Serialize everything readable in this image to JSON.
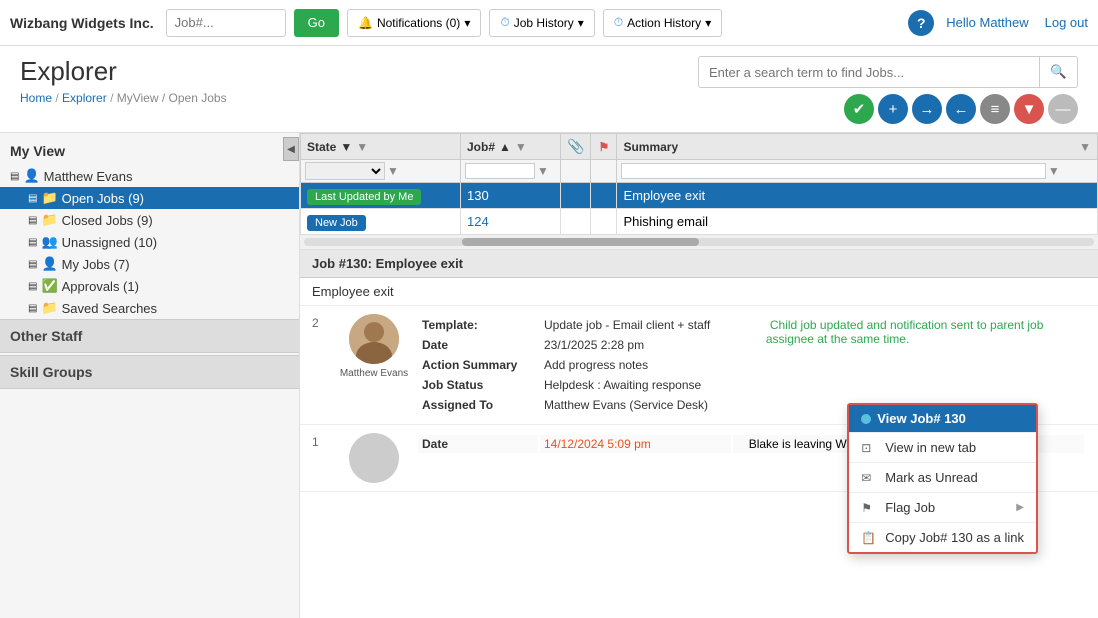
{
  "brand": "Wizbang Widgets Inc.",
  "nav": {
    "job_placeholder": "Job#...",
    "go_label": "Go",
    "notifications_label": "Notifications (0)",
    "job_history_label": "Job History",
    "action_history_label": "Action History",
    "hello_label": "Hello Matthew",
    "logout_label": "Log out"
  },
  "page": {
    "title": "Explorer",
    "breadcrumb_home": "Home",
    "breadcrumb_explorer": "Explorer",
    "breadcrumb_current": "MyView / Open Jobs",
    "search_placeholder": "Enter a search term to find Jobs..."
  },
  "toolbar": {
    "icons": [
      "✔",
      "+",
      "→",
      "←",
      "≡",
      "▼",
      "—"
    ]
  },
  "sidebar": {
    "title": "My View",
    "user": "Matthew Evans",
    "items": [
      {
        "label": "Open Jobs (9)",
        "active": true,
        "icon": "📁",
        "count": "9"
      },
      {
        "label": "Closed Jobs (9)",
        "active": false,
        "icon": "📁",
        "count": "9"
      },
      {
        "label": "Unassigned (10)",
        "active": false,
        "icon": "👥",
        "count": "10"
      },
      {
        "label": "My Jobs (7)",
        "active": false,
        "icon": "👤",
        "count": "7"
      },
      {
        "label": "Approvals (1)",
        "active": false,
        "icon": "✅",
        "count": "1"
      },
      {
        "label": "Saved Searches",
        "active": false,
        "icon": "📁"
      }
    ],
    "other_staff_label": "Other Staff",
    "skill_groups_label": "Skill Groups"
  },
  "table": {
    "columns": [
      "State",
      "Job#",
      "",
      "",
      "Summary"
    ],
    "rows": [
      {
        "state_badge": "Last Updated by Me",
        "state_badge_class": "badge-green",
        "job_num": "130",
        "summary": "Employee exit",
        "selected": true
      },
      {
        "state_badge": "New Job",
        "state_badge_class": "badge-blue",
        "job_num": "124",
        "summary": "Phishing email",
        "selected": false
      }
    ]
  },
  "job_detail": {
    "header": "Job #130: Employee exit",
    "subject": "Employee exit",
    "actions": [
      {
        "num": "2",
        "agent": "Matthew Evans",
        "template": "Update job - Email client + staff",
        "date": "23/1/2025 2:28 pm",
        "action_summary": "Add progress notes",
        "job_status": "Helpdesk : Awaiting response",
        "assigned_to": "Matthew Evans (Service Desk)",
        "note": "Child job updated and notification sent to parent job assignee at the same time."
      },
      {
        "num": "1",
        "agent": "",
        "template": "",
        "date": "14/12/2024 5:09 pm",
        "action_summary": "",
        "job_status": "",
        "assigned_to": "",
        "note": "Blake is leaving WBW from Feb 1st."
      }
    ]
  },
  "context_menu": {
    "header": "View Job# 130",
    "items": [
      {
        "icon": "⊡",
        "label": "View in new tab",
        "arrow": false
      },
      {
        "icon": "✉",
        "label": "Mark as Unread",
        "arrow": false
      },
      {
        "icon": "🚩",
        "label": "Flag Job",
        "arrow": true
      },
      {
        "icon": "📋",
        "label": "Copy Job# 130 as a link",
        "arrow": false
      }
    ]
  }
}
